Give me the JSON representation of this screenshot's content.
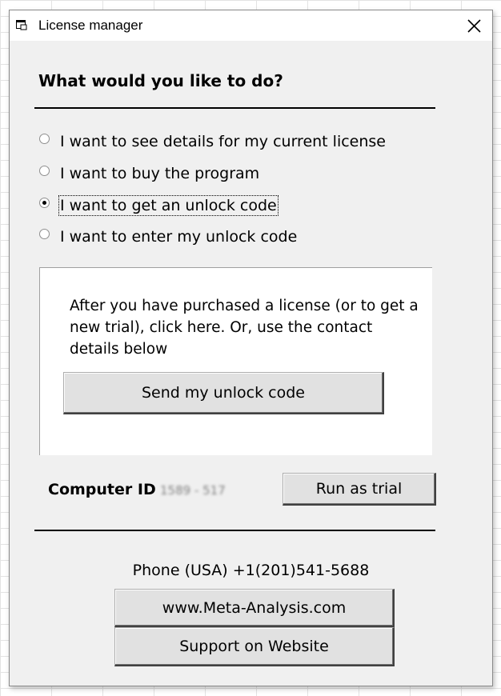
{
  "window": {
    "title": "License manager",
    "icon": "license-window-icon",
    "close_icon": "close-x-icon"
  },
  "heading": "What would you like to do?",
  "options": [
    {
      "label": "I want to see details for my current license",
      "selected": false
    },
    {
      "label": "I want to buy the program",
      "selected": false
    },
    {
      "label": "I want to get an unlock code",
      "selected": true
    },
    {
      "label": "I want to enter my unlock code",
      "selected": false
    }
  ],
  "panel": {
    "description": "After you have purchased a license (or to get a new trial), click here.  Or, use the contact details below",
    "send_button": "Send my unlock code"
  },
  "computer_id": {
    "label": "Computer ID",
    "value": "1589 - 517"
  },
  "run_trial_button": "Run as trial",
  "contact": {
    "phone": "Phone (USA) +1(201)541-5688",
    "website_button": "www.Meta-Analysis.com",
    "support_button": "Support on Website"
  }
}
